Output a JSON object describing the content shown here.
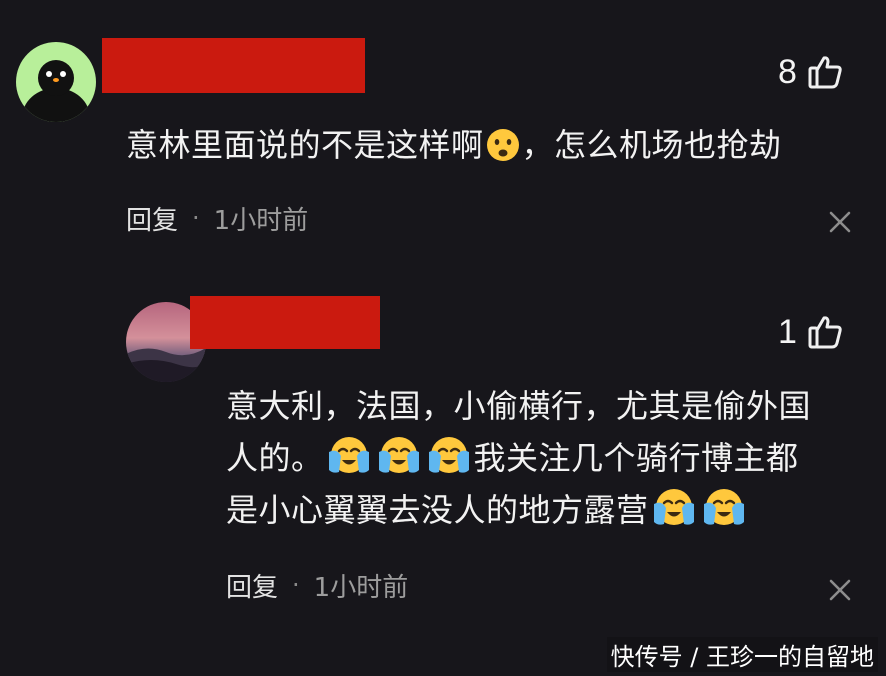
{
  "comments": [
    {
      "likes": "8",
      "text_lines": [
        {
          "before": "意林里面说的不是这样啊",
          "after": "，怎么机场也抢劫"
        }
      ],
      "emoji_names": [
        "frowning-face-emoji"
      ],
      "reply_label": "回复",
      "separator": "·",
      "time": "1小时前"
    },
    {
      "likes": "1",
      "text_lines": [
        "意大利，法国，小偷横行，尤其是偷外国",
        {
          "before": "人的。",
          "after": "我关注几个骑行博主都"
        },
        {
          "before": "是小心翼翼去没人的地方露营",
          "after": ""
        }
      ],
      "emoji_names": [
        "loudly-crying-face-emoji"
      ],
      "reply_label": "回复",
      "separator": "·",
      "time": "1小时前"
    }
  ],
  "watermark": "快传号 / 王珍一的自留地",
  "colors": {
    "background": "#17161b",
    "redaction": "#cb1a0f",
    "avatar1_bg": "#b8ef9a"
  },
  "icons": {
    "like": "thumbs-up-outline-icon",
    "close": "close-icon"
  }
}
